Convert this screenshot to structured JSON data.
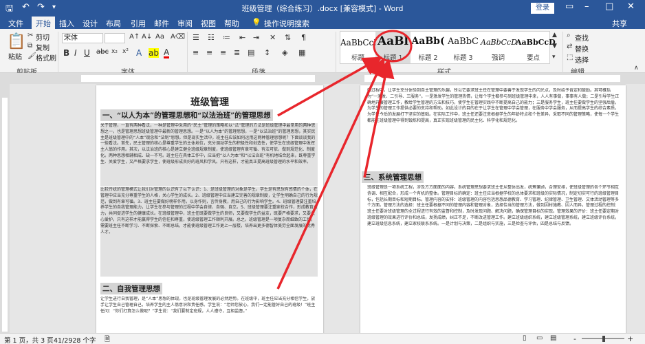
{
  "window": {
    "title": "班级管理（综合练习）.docx [兼容模式] - Word",
    "login_label": "登录",
    "minimize_glyph": "–",
    "maximize_glyph": "□",
    "close_glyph": "✕",
    "restore_glyph": "▭"
  },
  "tabs": {
    "file": "文件",
    "home": "开始",
    "insert": "插入",
    "design": "设计",
    "layout": "布局",
    "references": "引用",
    "mailings": "邮件",
    "review": "审阅",
    "view": "视图",
    "help": "帮助",
    "tell_me": "操作说明搜索",
    "share": "共享"
  },
  "clipboard": {
    "paste": "粘贴",
    "cut": "剪切",
    "copy": "复制",
    "format_painter": "格式刷",
    "group_label": "剪贴板"
  },
  "font": {
    "font_name": "宋体",
    "group_label": "字体"
  },
  "paragraph": {
    "group_label": "段落"
  },
  "styles": {
    "group_label": "样式",
    "items": [
      {
        "preview": "AaBbCcDd",
        "label": "标题"
      },
      {
        "preview": "AaBl",
        "label": "标题 1"
      },
      {
        "preview": "AaBb(",
        "label": "标题 2"
      },
      {
        "preview": "AaBbC",
        "label": "标题 3"
      },
      {
        "preview": "AaBbCcD",
        "label": "强调"
      },
      {
        "preview": "AaBbCcD",
        "label": "要点"
      }
    ]
  },
  "editing": {
    "find": "查找",
    "replace": "替换",
    "select": "选择",
    "group_label": "编辑"
  },
  "document": {
    "title": "班级管理",
    "heading1": "一、“以人为本”的管理思想和“以法治班”的管理思想",
    "para1": "关于管理，一直有两种看法，一种是管理中采用的“民主”管理的策略和以“法”管理的方法是班级管理中最常用的两种思想之一，也是管理思想班级管理中最新的管理思想。一是“以人为本”的管理思想，一是“以法治班”的管理思想，其实民主是班级管理中的“人本”观念和“法制”思想。但是现实生活中，班主任应该如何运用这两种管理思想呢？下面谈谈我的一些看法。首先，民主管理的核心是尊重学生的主体地位，充分调动学生的积极性和创造性，使学生在班级管理中发挥主人翁的作用。其次，以法治班的核心是建立健全班级规章制度，使班级管理有章可循、有法可依，做到规范化、制度化。两种思想相辅相成、缺一不可。班主任在具体工作中，应当把“以人为本”和“以法治班”有机地结合起来，既尊重学生、关爱学生，又严格要求学生，使班级形成良好的班风和学风。只有这样，才能真正提高班级管理的水平和效率。",
    "para2": "比较传统的管理模式让我们对管理的认识有了以下认识：1、是班级管理的对象是学生，学生是有思想有感情的个体，在管理中应当充分尊重学生的人格，关心学生的成长。2、班级管理中应当建立完善的规章制度，让学生明确自己的行为规范，做到有章可循。3、班主任要做好榜样作用，以身作则，言传身教，用自己的行为影响学生。4、班级管理要注重培养学生的自我管理能力，让学生在参与管理的过程中学会自律、自强、自立。5、班级管理要注重家校合作，形成教育合力，共同促进学生的健康成长。在班级管理中，班主任既要做学生的良师，又要做学生的益友，既要严格要求，又要关心爱护，只有这样才能赢得学生的信任和尊重，使班级管理工作顺利开展。总之，班级管理是一项复杂而细致的工作，需要班主任不断学习、不断探索、不断总结，才能使班级管理工作更上一层楼，培养出更多德智体美劳全面发展的优秀人才。",
    "heading2": "二、自我管理思想",
    "para3": "让学生进行自我管理，是“人本”思想的体现，也是班级管理发展的必然趋势。在班级中，班主任应当充分相信学生，放手让学生自己管理自己，培养学生的主人翁意识和责任感。学生说：“老师您放心，我们一定能管好自己的班级！”班主任问：“你们打算怎么做呢？”学生说：“我们要制定班规，人人遵守，互相监督。”",
    "right_para1": "的过程中，让学生充分体验到自主管理的乐趣，所以它要求班主任在管理中要善于发现学生的闪光点，及时给予肯定和鼓励。其可概括为“一激发、二引导、三服务”。一是激发学生的管理热情，让每个学生都参与到班级管理中来，人人有事做，事事有人做；二是引导学生正确地开展管理工作，教给学生管理的方法和技巧，使学生在管理实践中不断提高自己的能力；三是服务学生，班主任要做学生的坚强后盾，为学生的管理工作提供必要的支持和帮助。如此设计的目的在于让学生在管理中学会管理，在服务中学会服务，从而提高学生的综合素质，为学生今后的发展打下坚实的基础。在实际工作中，班主任还要注意根据学生的年龄特点和个性差异，采取不同的管理策略，使每一个学生都能在班级管理中得到锻炼和提高，真正实现班级管理的民主化、科学化和规范化。",
    "heading3": "三、系统管理思想",
    "right_para2": "班级管理是一项系统工程，涉及方方面面的内容。系统管理思想要求班主任从整体出发，统筹兼顾，合理安排，使班级管理的各个环节相互协调、相互配合，形成一个有机的整体。管理目标的确定：班主任应当根据学校的总体要求和班级的实际情况，制定切实可行的班级管理目标，包括长期目标和短期目标。管理内容的安排：班级管理的内容包括思想品德教育、学习管理、纪律管理、卫生管理、文体活动管理等多个方面。管理方法的选择：班主任要根据不同的管理内容和管理对象，选择恰当的管理方法，做到因材施教、因人而异。管理过程的控制：班主任要对班级管理的全过程进行有效的监督和控制，及时发现问题、解决问题，确保管理目标的实现。管理效果的评价：班主任要定期对班级管理的效果进行评价和总结，发扬成绩，纠正不足，不断改进管理工作。建立班级组织系统，建立班级管理系统，建立班级评价系统，建立班级信息系统，建立家校联系系统。一是计划与决策，二是组织与实施，三是检查与评估，四是总结与反馈。"
  },
  "status": {
    "page": "第 1 页，共 3 页",
    "words": "41/2928 个字",
    "zoom_minus": "-",
    "zoom_plus": "+"
  },
  "colors": {
    "accent": "#2b579a",
    "annotation": "#e8262c"
  }
}
